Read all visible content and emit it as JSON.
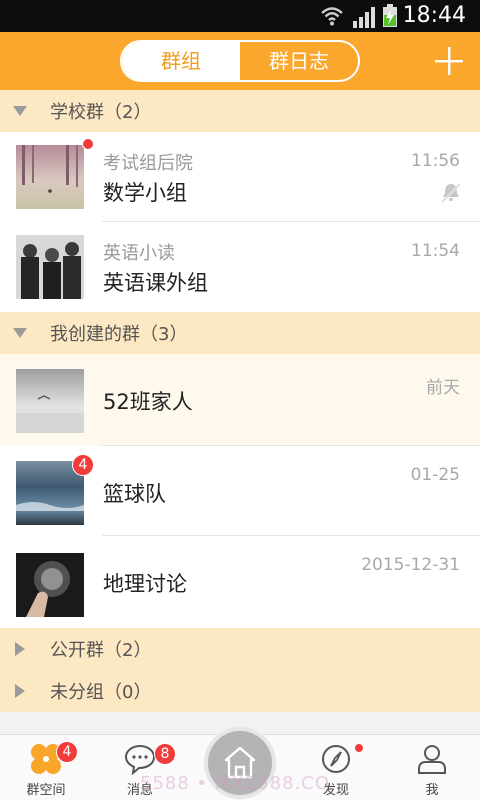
{
  "status_bar": {
    "time": "18:44"
  },
  "header": {
    "tabs": [
      {
        "label": "群组",
        "active": true
      },
      {
        "label": "群日志",
        "active": false
      }
    ],
    "add_icon": "plus-icon"
  },
  "sections": [
    {
      "label": "学校群（2）",
      "expanded": true
    },
    {
      "label": "我创建的群（3）",
      "expanded": true
    },
    {
      "label": "公开群（2）",
      "expanded": false
    },
    {
      "label": "未分组（0）",
      "expanded": false
    }
  ],
  "school_groups": [
    {
      "subtitle": "考试组后院",
      "title": "数学小组",
      "time": "11:56",
      "unread_dot": true,
      "muted": true
    },
    {
      "subtitle": "英语小读",
      "title": "英语课外组",
      "time": "11:54"
    }
  ],
  "created_groups": [
    {
      "title": "52班家人",
      "time": "前天"
    },
    {
      "title": "篮球队",
      "time": "01-25",
      "badge": "4"
    },
    {
      "title": "地理讨论",
      "time": "2015-12-31"
    }
  ],
  "bottom_nav": {
    "tabs": [
      {
        "label": "群空间",
        "badge": "4",
        "icon": "group-space-icon"
      },
      {
        "label": "消息",
        "badge": "8",
        "icon": "message-icon"
      },
      {
        "label": "发现",
        "icon": "compass-icon"
      },
      {
        "label": "我",
        "icon": "user-icon"
      }
    ],
    "home_icon": "home-icon",
    "watermark": "5588 • MX5588.CO"
  },
  "colors": {
    "accent": "#fba72e",
    "section_bg": "#fde8c4",
    "badge": "#f23c3c"
  }
}
